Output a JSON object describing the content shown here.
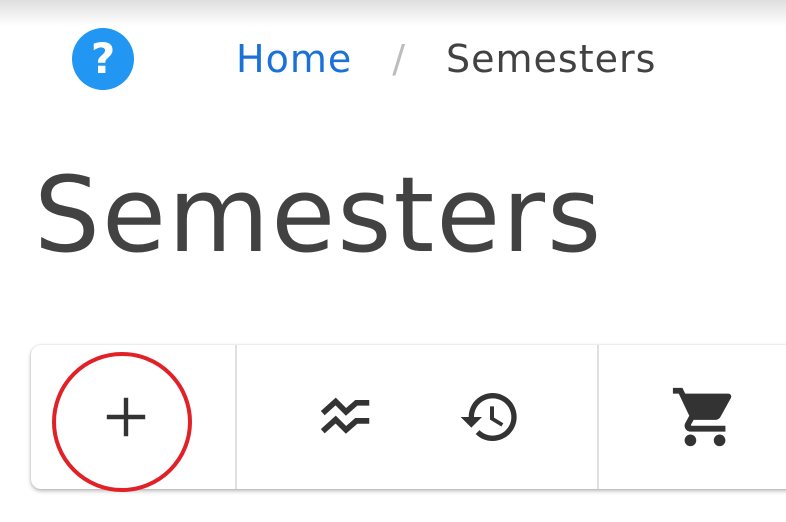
{
  "header": {
    "help_icon": "help-circle-icon",
    "help_glyph": "?",
    "help_color": "#2196f3"
  },
  "breadcrumb": {
    "home": "Home",
    "separator": "/",
    "current": "Semesters",
    "link_color": "#1a72d9"
  },
  "page": {
    "title": "Semesters"
  },
  "toolbar": {
    "buttons": [
      {
        "icon": "add-icon"
      },
      {
        "icon": "compare-trend-icon"
      },
      {
        "icon": "history-icon"
      },
      {
        "icon": "cart-icon"
      }
    ],
    "highlight_color": "#e02228"
  }
}
